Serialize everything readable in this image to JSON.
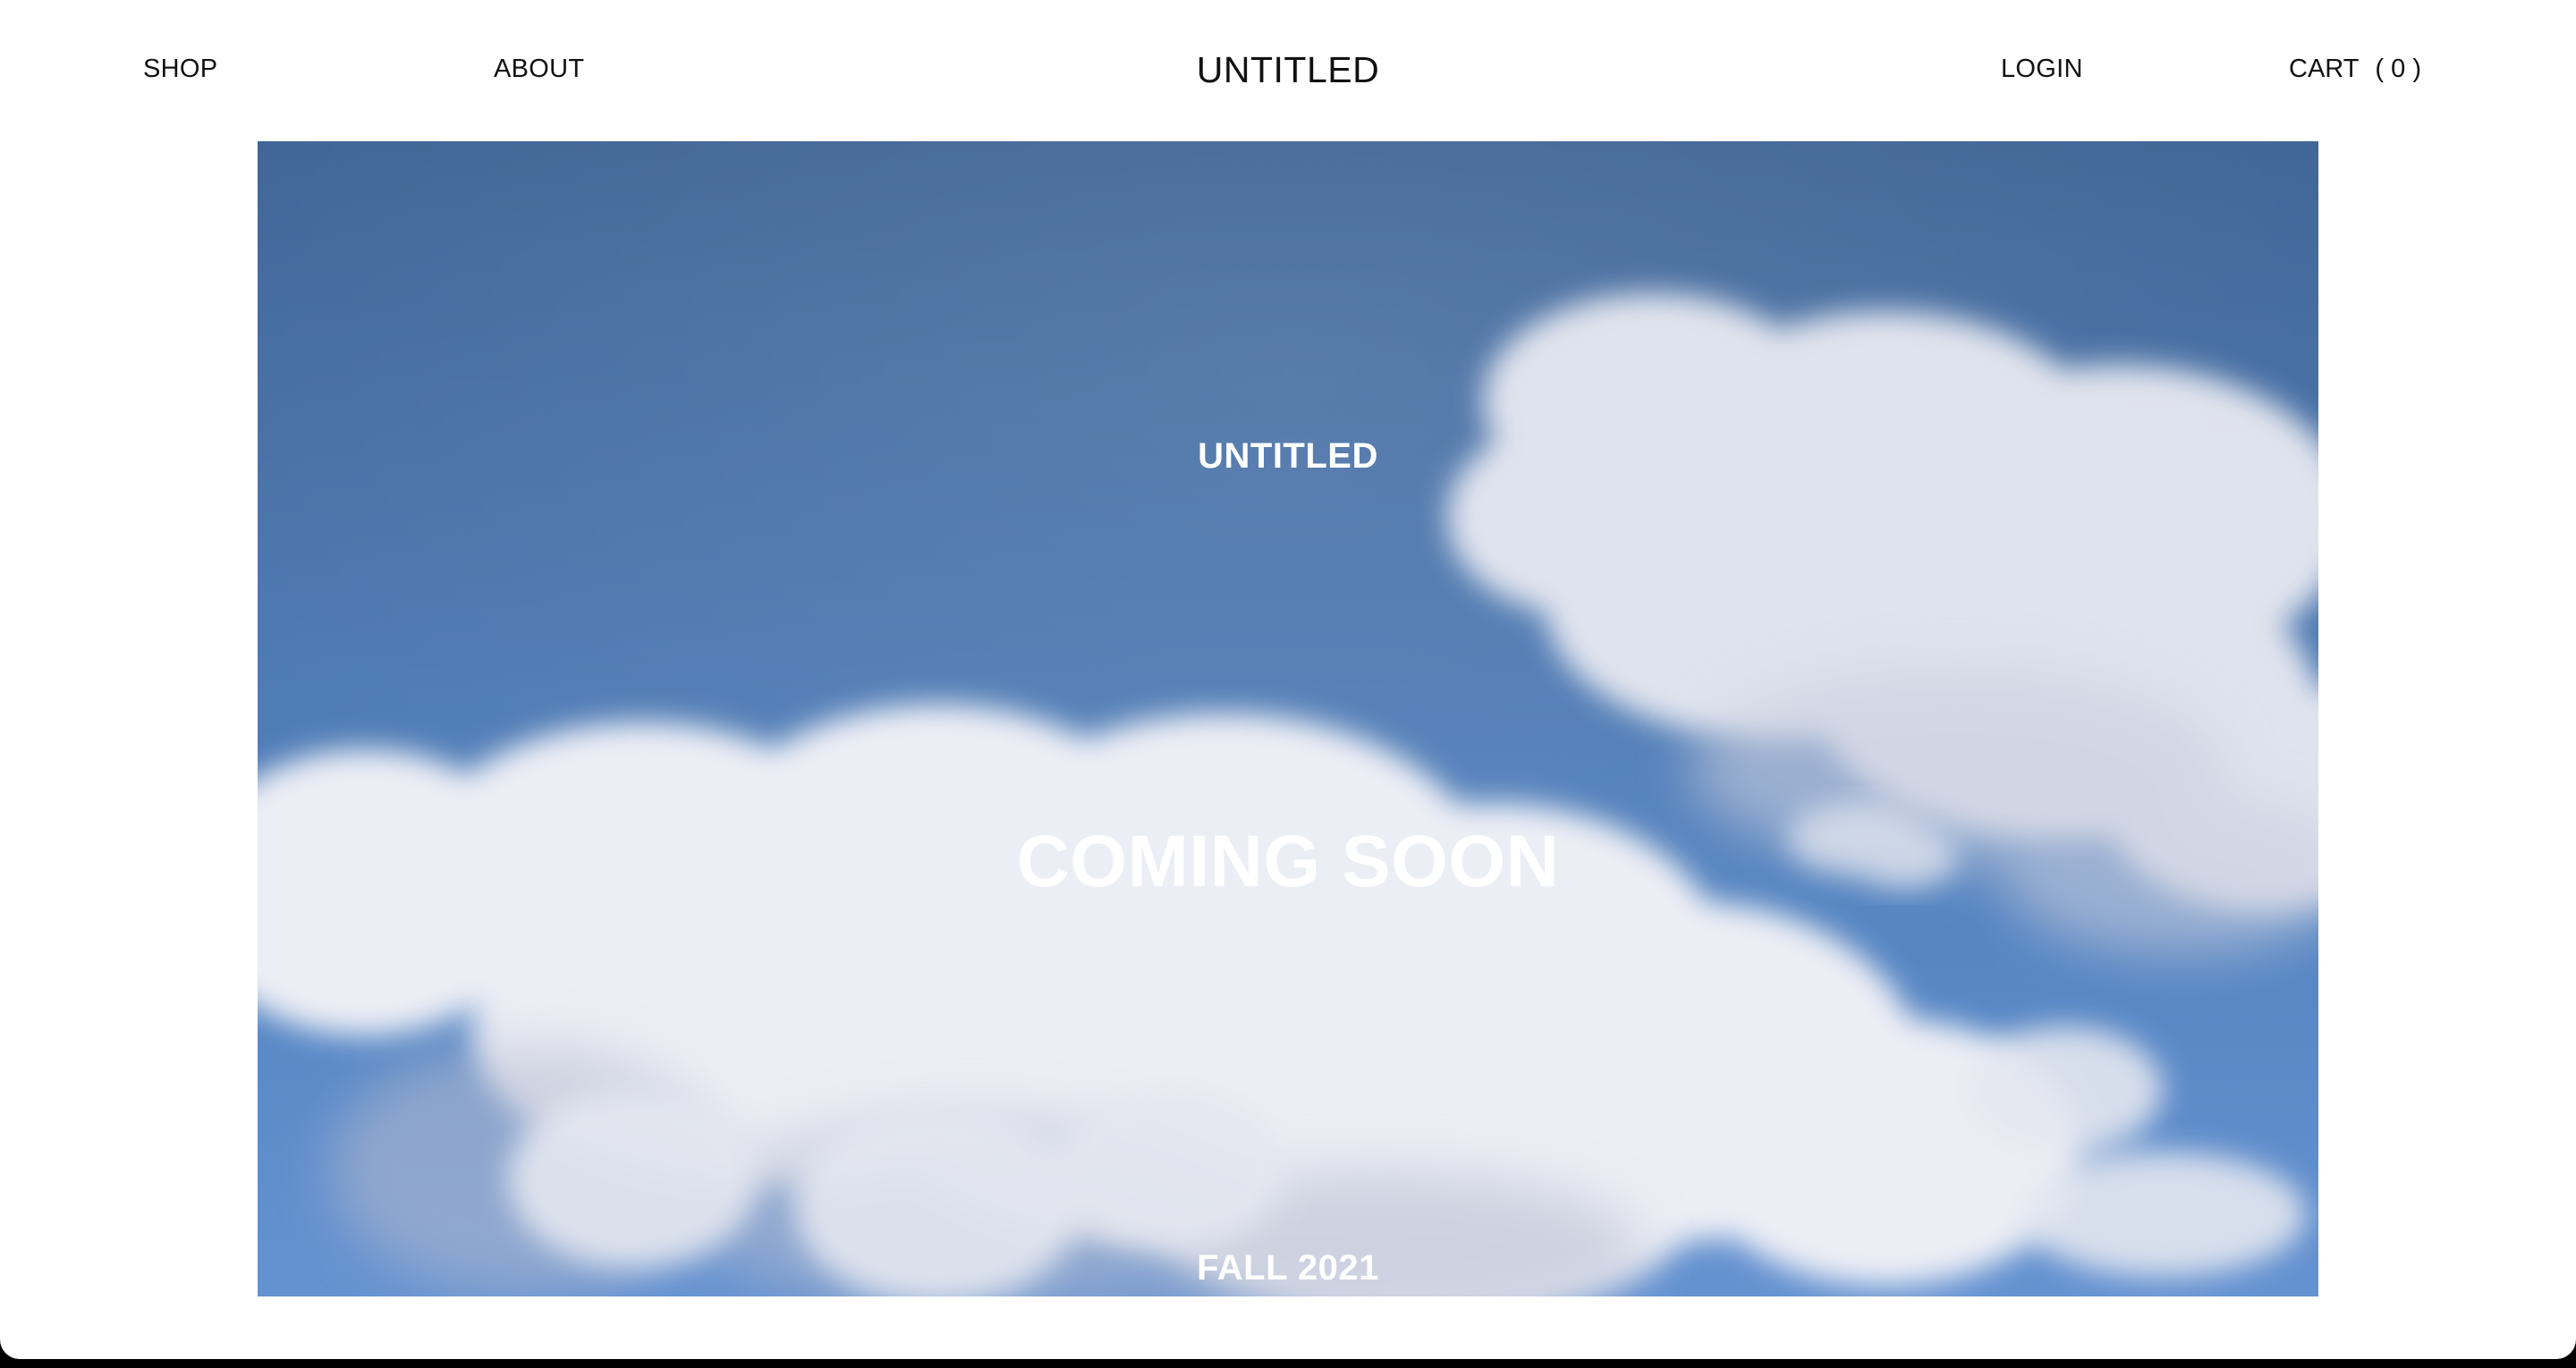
{
  "nav": {
    "shop": "SHOP",
    "about": "ABOUT",
    "login": "LOGIN",
    "cart_label": "CART",
    "cart_count": "( 0 )"
  },
  "brand": {
    "logo": "UNTITLED"
  },
  "hero": {
    "brand": "UNTITLED",
    "headline": "COMING SOON",
    "season": "FALL 2021",
    "background": "sky-with-clouds"
  },
  "colors": {
    "page": "#ffffff",
    "text": "#111111",
    "sky": "#4a74ab",
    "hero_text": "#ffffff"
  }
}
